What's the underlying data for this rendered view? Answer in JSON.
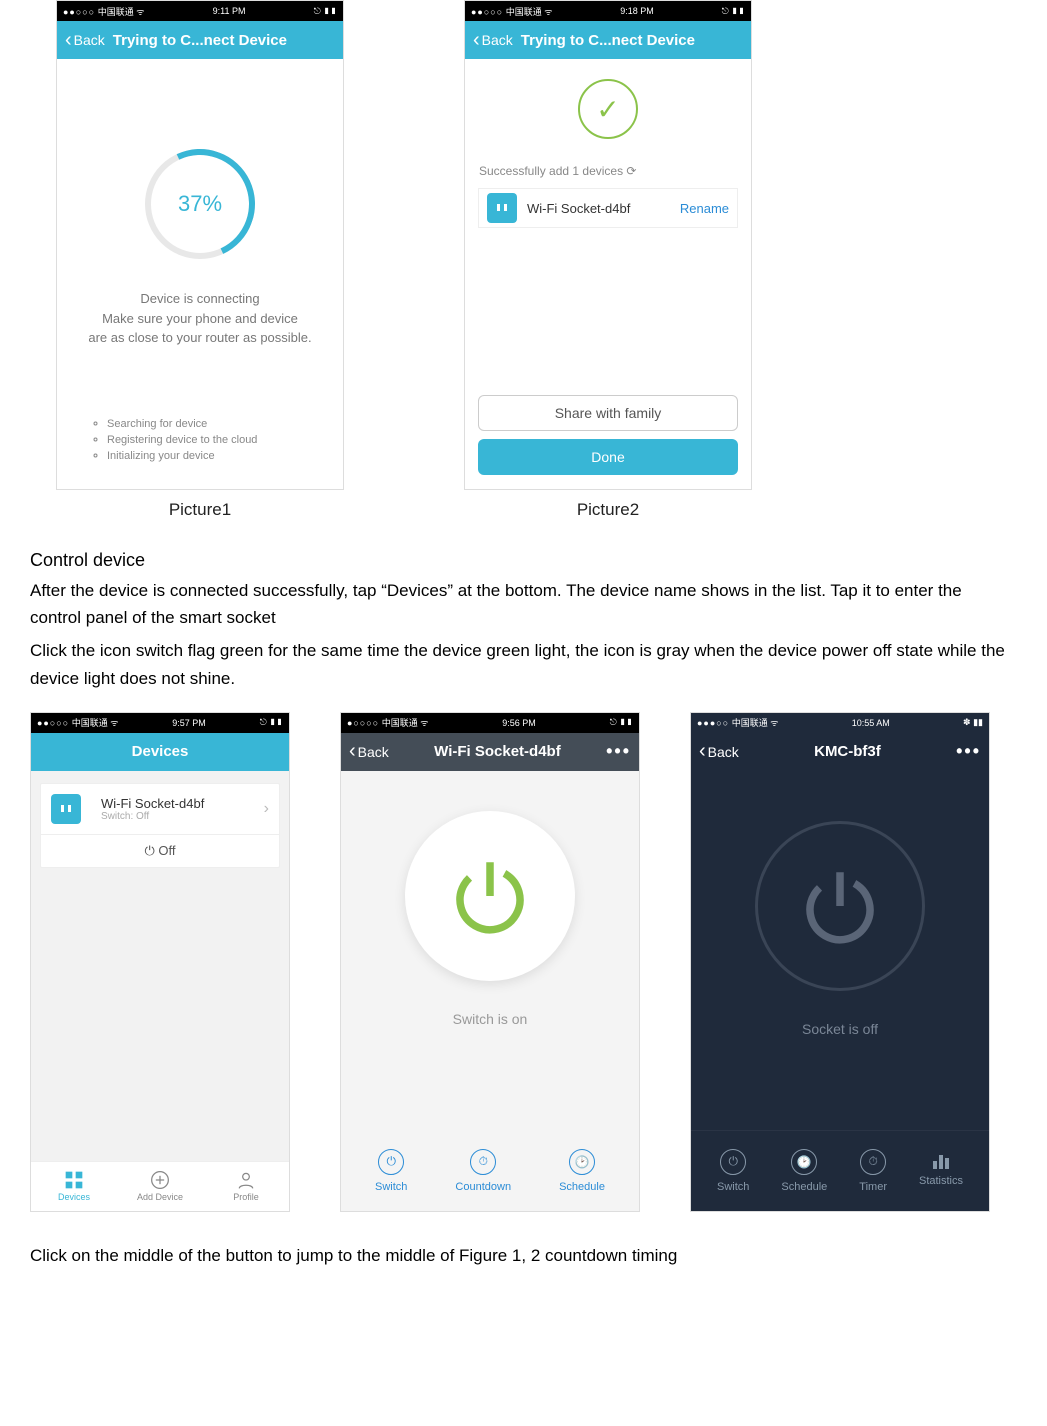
{
  "picture1": {
    "status": {
      "carrier": "中国联通",
      "time": "9:11 PM",
      "signal": "●●○○○",
      "icons": "⎋ ▮▮"
    },
    "nav": {
      "back": "Back",
      "title": "Trying to C...nect Device"
    },
    "progress": "37%",
    "connecting_line1": "Device is connecting",
    "connecting_line2": "Make sure your phone and device",
    "connecting_line3": "are as close to your router as possible.",
    "steps": [
      "Searching for device",
      "Registering device to the cloud",
      "Initializing your device"
    ],
    "caption": "Picture1"
  },
  "picture2": {
    "status": {
      "carrier": "中国联通",
      "time": "9:18 PM",
      "signal": "●●○○○",
      "icons": "⎋ ▮▮"
    },
    "nav": {
      "back": "Back",
      "title": "Trying to C...nect Device"
    },
    "success": "Successfully add 1 devices",
    "device_name": "Wi-Fi Socket-d4bf",
    "rename": "Rename",
    "share": "Share with family",
    "done": "Done",
    "caption": "Picture2"
  },
  "section": {
    "title": "Control device",
    "para1": "After the device is connected successfully, tap “Devices” at the bottom. The device name shows in the list. Tap it to enter the control panel of the smart socket",
    "para2": "Click the icon switch flag green for the same time the device green light, the icon is gray when the device power off state while the device light does not shine."
  },
  "dev_list": {
    "status": {
      "carrier": "中国联通",
      "time": "9:57 PM",
      "signal": "●●○○○",
      "icons": "⎋ ▮▮"
    },
    "title": "Devices",
    "device_name": "Wi-Fi Socket-d4bf",
    "device_sub": "Switch: Off",
    "off": "Off",
    "tabs": [
      "Devices",
      "Add Device",
      "Profile"
    ]
  },
  "ctrl_on": {
    "status": {
      "carrier": "中国联通",
      "time": "9:56 PM",
      "signal": "●○○○○",
      "icons": "⎋ ▮▮"
    },
    "back": "Back",
    "title": "Wi-Fi Socket-d4bf",
    "more": "•••",
    "state": "Switch is on",
    "items": [
      "Switch",
      "Countdown",
      "Schedule"
    ]
  },
  "ctrl_off": {
    "status": {
      "carrier": "中国联通",
      "time": "10:55 AM",
      "signal": "●●●○○",
      "icons": "✽ ▮▮"
    },
    "back": "Back",
    "title": "KMC-bf3f",
    "more": "•••",
    "state": "Socket is off",
    "items": [
      "Switch",
      "Schedule",
      "Timer",
      "Statistics"
    ]
  },
  "footer": "Click on the middle of the button to jump to the middle of Figure 1, 2 countdown timing"
}
